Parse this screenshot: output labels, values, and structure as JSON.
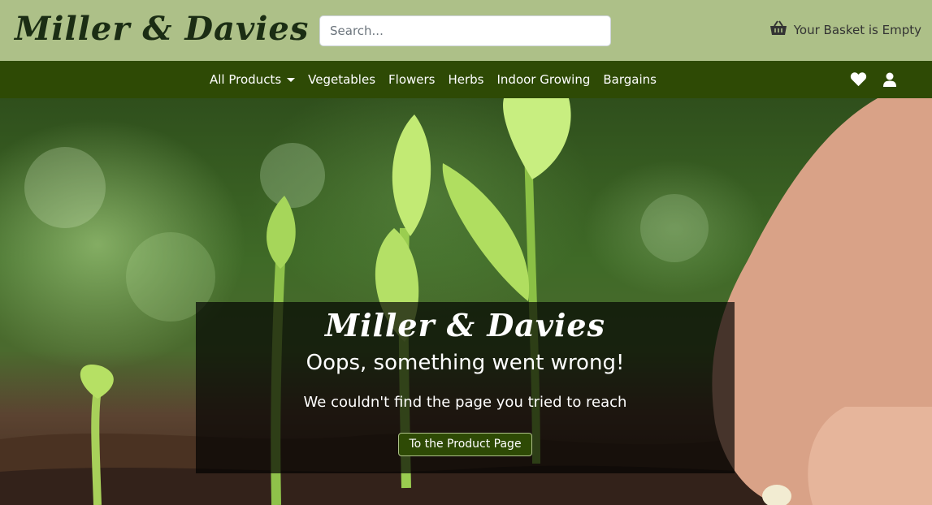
{
  "header": {
    "brand": "Miller & Davies",
    "search_placeholder": "Search...",
    "basket_label": "Your Basket is Empty",
    "basket_icon": "shopping-basket-icon"
  },
  "nav": {
    "items": [
      {
        "label": "All Products",
        "dropdown": true
      },
      {
        "label": "Vegetables"
      },
      {
        "label": "Flowers"
      },
      {
        "label": "Herbs"
      },
      {
        "label": "Indoor Growing"
      },
      {
        "label": "Bargains"
      }
    ],
    "icons": [
      "heart-icon",
      "user-icon"
    ]
  },
  "hero": {
    "brand": "Miller & Davies",
    "heading": "Oops, something went wrong!",
    "message": "We couldn't find the page you tried to reach",
    "button_label": "To the Product Page"
  },
  "colors": {
    "topbar": "#adc088",
    "navbar": "#2e4a05",
    "brand_text": "#1b2d14"
  }
}
